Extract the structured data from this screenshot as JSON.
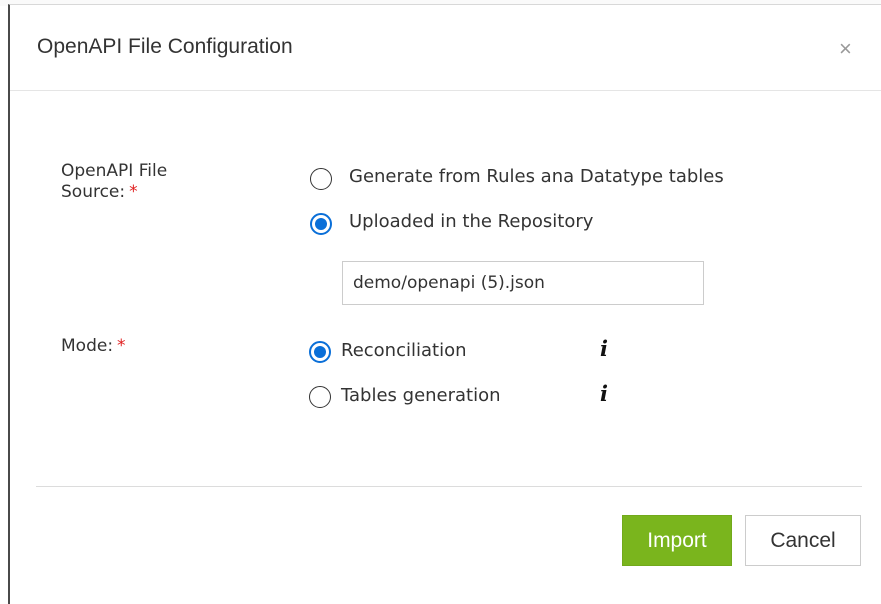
{
  "dialog": {
    "title": "OpenAPI File Configuration",
    "close_glyph": "×"
  },
  "form": {
    "source": {
      "label": "OpenAPI File Source:",
      "required_mark": "*",
      "options": [
        {
          "label": "Generate from Rules ana Datatype tables",
          "selected": false
        },
        {
          "label": "Uploaded in the Repository",
          "selected": true
        }
      ],
      "file_path_value": "demo/openapi (5).json"
    },
    "mode": {
      "label": "Mode:",
      "required_mark": "*",
      "options": [
        {
          "label": "Reconciliation",
          "selected": true,
          "info_icon": "i"
        },
        {
          "label": "Tables generation",
          "selected": false,
          "info_icon": "i"
        }
      ]
    }
  },
  "footer": {
    "import_label": "Import",
    "cancel_label": "Cancel"
  },
  "colors": {
    "accent_green": "#7ab51d",
    "radio_blue": "#0a6fd8",
    "required_red": "#e02020"
  }
}
